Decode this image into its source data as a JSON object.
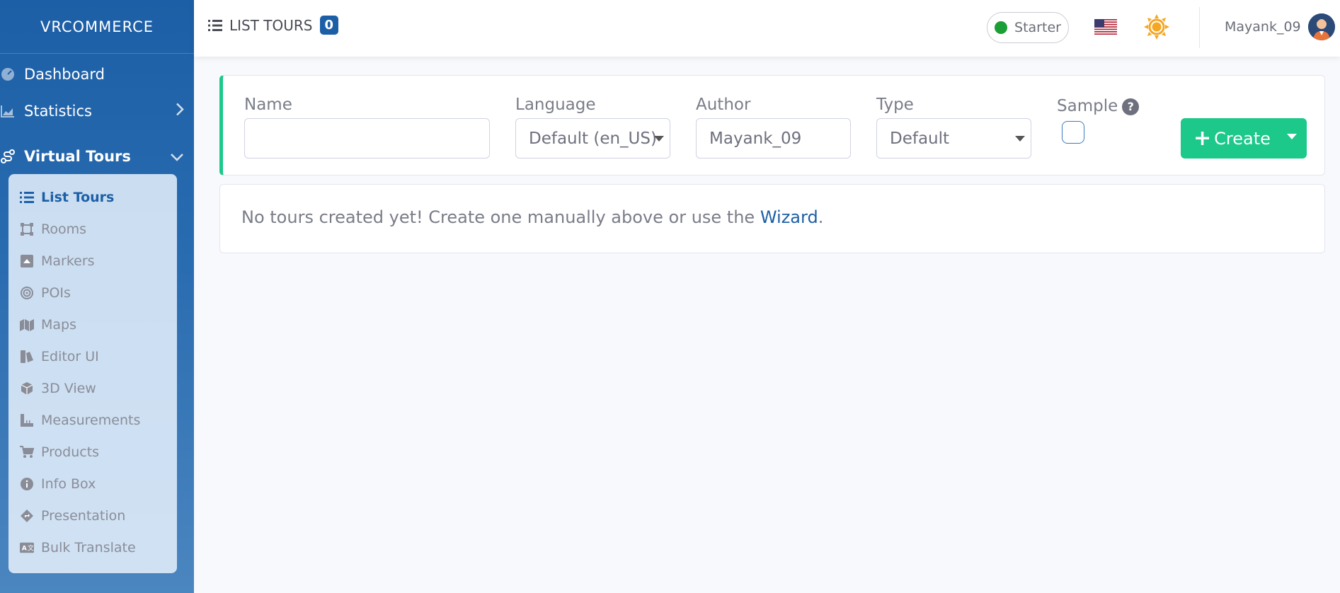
{
  "sidebar": {
    "brand": "VRCOMMERCE",
    "items": [
      {
        "label": "Dashboard",
        "icon": "dashboard-icon"
      },
      {
        "label": "Statistics",
        "icon": "chart-icon"
      },
      {
        "label": "Virtual Tours",
        "icon": "route-icon"
      }
    ],
    "submenu": [
      {
        "label": "List Tours",
        "icon": "list-icon",
        "active": true
      },
      {
        "label": "Rooms",
        "icon": "vector-square-icon"
      },
      {
        "label": "Markers",
        "icon": "caret-square-icon"
      },
      {
        "label": "POIs",
        "icon": "bullseye-icon"
      },
      {
        "label": "Maps",
        "icon": "map-icon"
      },
      {
        "label": "Editor UI",
        "icon": "swatchbook-icon"
      },
      {
        "label": "3D View",
        "icon": "cube-icon"
      },
      {
        "label": "Measurements",
        "icon": "ruler-icon"
      },
      {
        "label": "Products",
        "icon": "cart-icon"
      },
      {
        "label": "Info Box",
        "icon": "info-circle-icon"
      },
      {
        "label": "Presentation",
        "icon": "directions-icon"
      },
      {
        "label": "Bulk Translate",
        "icon": "language-icon"
      }
    ]
  },
  "header": {
    "title": "LIST TOURS",
    "count": "0",
    "plan": "Starter",
    "username": "Mayank_09"
  },
  "filters": {
    "name_label": "Name",
    "name_value": "",
    "language_label": "Language",
    "language_value": "Default (en_US)",
    "author_label": "Author",
    "author_value": "Mayank_09",
    "type_label": "Type",
    "type_value": "Default",
    "sample_label": "Sample",
    "sample_help": "?",
    "create_label": "Create"
  },
  "empty": {
    "message": "No tours created yet! Create one manually above or use the ",
    "link": "Wizard",
    "suffix": "."
  },
  "colors": {
    "sidebar": "#1d5fa6",
    "accent_green": "#1cc88a",
    "plan_dot": "#1b9e36",
    "sun": "#f6a623"
  }
}
